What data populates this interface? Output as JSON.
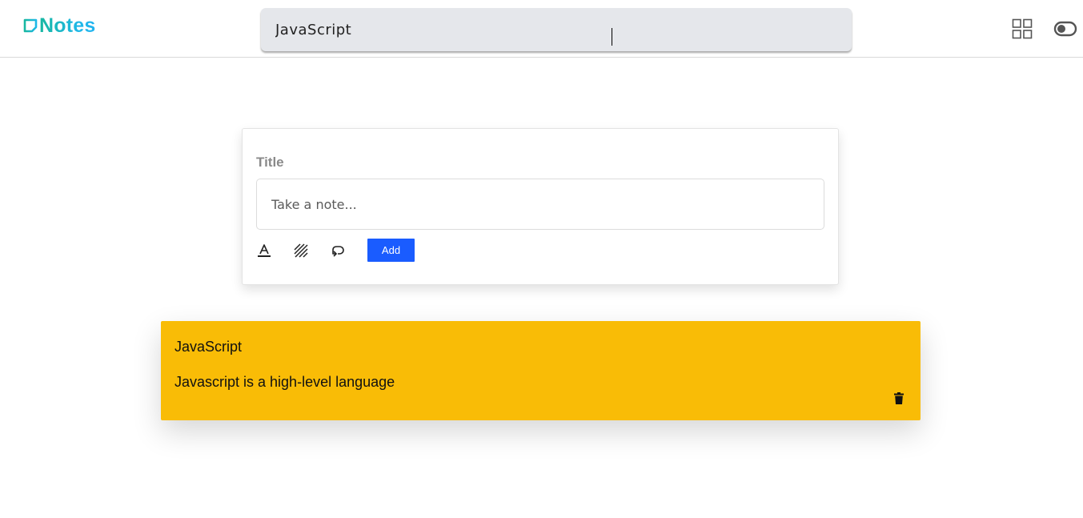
{
  "header": {
    "brand": "Notes",
    "brand_icon": "note-square-icon",
    "search": {
      "value": "JavaScript",
      "icon": "search-icon"
    },
    "grid_view_icon": "grid-view-icon",
    "theme_toggle_icon": "toggle-icon"
  },
  "composer": {
    "title_placeholder": "Title",
    "note_placeholder": "Take a note...",
    "tools": [
      "text-color-icon",
      "background-pattern-icon",
      "undo-icon"
    ],
    "add_label": "Add",
    "add_color": "#1a5cff"
  },
  "notes": [
    {
      "title": "JavaScript",
      "body": "Javascript is a high-level language",
      "color": "#f9bc06",
      "delete_icon": "trash-icon"
    }
  ]
}
